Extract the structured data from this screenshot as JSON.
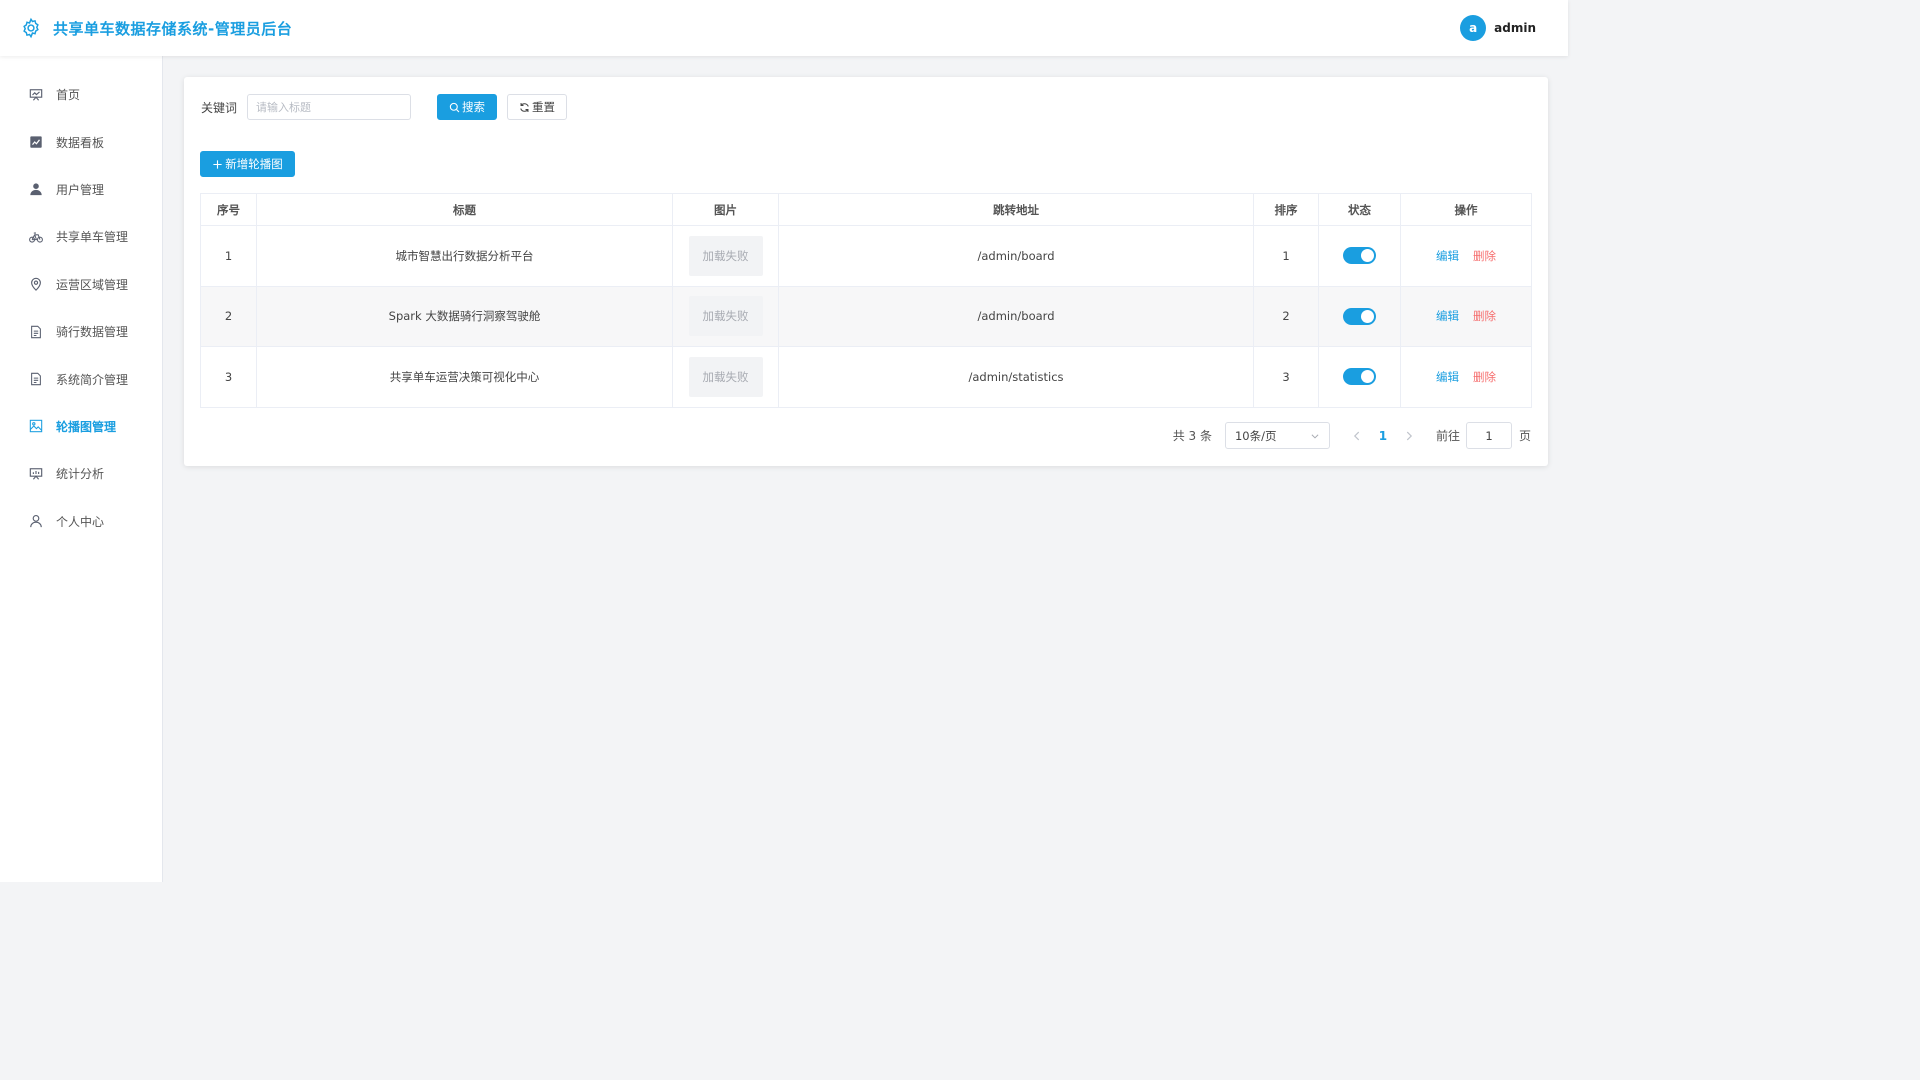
{
  "header": {
    "title": "共享单车数据存储系统-管理员后台",
    "brand_icon": "gear-icon",
    "avatar_letter": "a",
    "username": "admin",
    "accent_color": "#1a9ee0"
  },
  "sidebar": {
    "items": [
      {
        "label": "首页",
        "icon": "presentation-icon"
      },
      {
        "label": "数据看板",
        "icon": "chart-icon"
      },
      {
        "label": "用户管理",
        "icon": "user-icon"
      },
      {
        "label": "共享单车管理",
        "icon": "bicycle-icon"
      },
      {
        "label": "运营区域管理",
        "icon": "location-icon"
      },
      {
        "label": "骑行数据管理",
        "icon": "document-icon"
      },
      {
        "label": "系统简介管理",
        "icon": "document-icon"
      },
      {
        "label": "轮播图管理",
        "icon": "image-icon",
        "active": true
      },
      {
        "label": "统计分析",
        "icon": "presentation-icon"
      },
      {
        "label": "个人中心",
        "icon": "user-outline-icon"
      }
    ]
  },
  "filter": {
    "label": "关键词",
    "placeholder": "请输入标题",
    "value": "",
    "search_label": "搜索",
    "reset_label": "重置"
  },
  "add_button_label": "新增轮播图",
  "table": {
    "columns": [
      "序号",
      "标题",
      "图片",
      "跳转地址",
      "排序",
      "状态",
      "操作"
    ],
    "rows": [
      {
        "index": "1",
        "title": "城市智慧出行数据分析平台",
        "image": "加载失败",
        "url": "/admin/board",
        "sort": "1",
        "status": true
      },
      {
        "index": "2",
        "title": "Spark 大数据骑行洞察驾驶舱",
        "image": "加载失败",
        "url": "/admin/board",
        "sort": "2",
        "status": true
      },
      {
        "index": "3",
        "title": "共享单车运营决策可视化中心",
        "image": "加载失败",
        "url": "/admin/statistics",
        "sort": "3",
        "status": true
      }
    ],
    "edit_label": "编辑",
    "delete_label": "删除"
  },
  "pagination": {
    "total_text": "共 3 条",
    "page_size": "10条/页",
    "current_page": "1",
    "goto_label": "前往",
    "goto_value": "1",
    "page_suffix": "页"
  }
}
